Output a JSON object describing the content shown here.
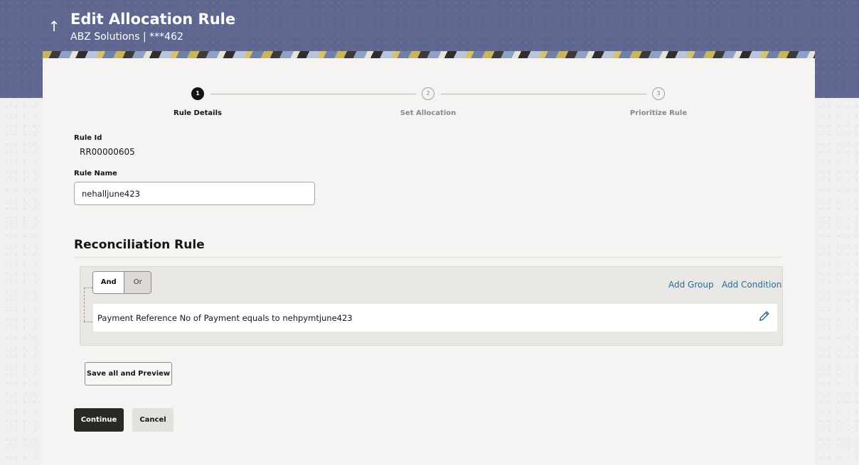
{
  "header": {
    "title": "Edit Allocation Rule",
    "subtitle": "ABZ Solutions | ***462",
    "back_icon": "arrow-up-icon",
    "brand_color": "#5f6791"
  },
  "stepper": {
    "steps": [
      {
        "number": "1",
        "label": "Rule Details",
        "state": "active"
      },
      {
        "number": "2",
        "label": "Set Allocation",
        "state": "pending"
      },
      {
        "number": "3",
        "label": "Prioritize Rule",
        "state": "pending"
      }
    ]
  },
  "form": {
    "rule_id_label": "Rule Id",
    "rule_id_value": "RR00000605",
    "rule_name_label": "Rule Name",
    "rule_name_value": "nehalljune423"
  },
  "reconciliation": {
    "title": "Reconciliation Rule",
    "operator_and": "And",
    "operator_or": "Or",
    "selected_operator": "And",
    "add_group": "Add Group",
    "add_condition": "Add Condition",
    "conditions": [
      {
        "text": "Payment Reference No of Payment equals to nehpymtjune423",
        "edit_icon": "pencil-icon"
      }
    ],
    "link_color": "#2f6b8f"
  },
  "actions": {
    "save_preview": "Save all and Preview",
    "continue": "Continue",
    "cancel": "Cancel"
  }
}
